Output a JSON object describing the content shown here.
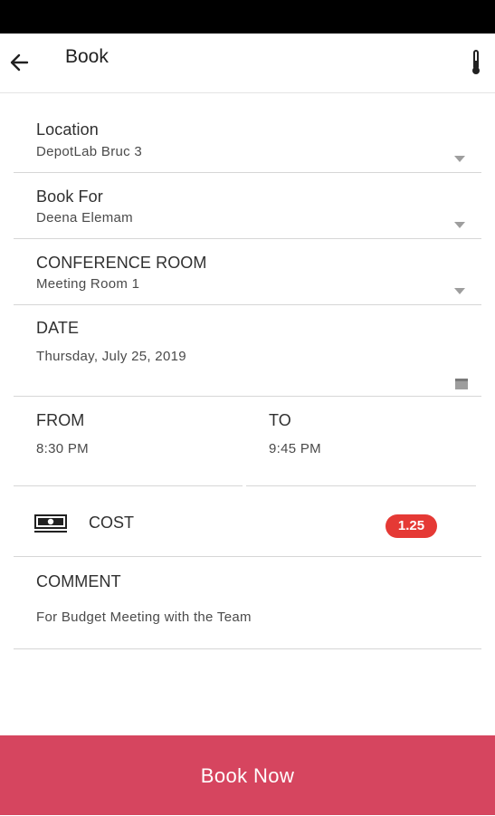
{
  "app_bar": {
    "title": "Book",
    "back_icon": "arrow-left-icon",
    "thermometer_icon": "thermometer-icon"
  },
  "form": {
    "location": {
      "label": "Location",
      "value": "DepotLab Bruc 3"
    },
    "book_for": {
      "label": "Book For",
      "value": "Deena Elemam"
    },
    "conference_room": {
      "label": "CONFERENCE ROOM",
      "value": "Meeting Room 1"
    },
    "date": {
      "label": "DATE",
      "value": "Thursday, July 25, 2019"
    },
    "from": {
      "label": "FROM",
      "value": "8:30 PM"
    },
    "to": {
      "label": "TO",
      "value": "9:45 PM"
    },
    "cost": {
      "label": "COST",
      "value": "1.25",
      "icon": "cash-icon",
      "badge_color": "#e53935"
    },
    "comment": {
      "label": "COMMENT",
      "value": "For Budget Meeting with the Team"
    }
  },
  "actions": {
    "book_now": "Book Now",
    "book_now_color": "#d6455f"
  }
}
